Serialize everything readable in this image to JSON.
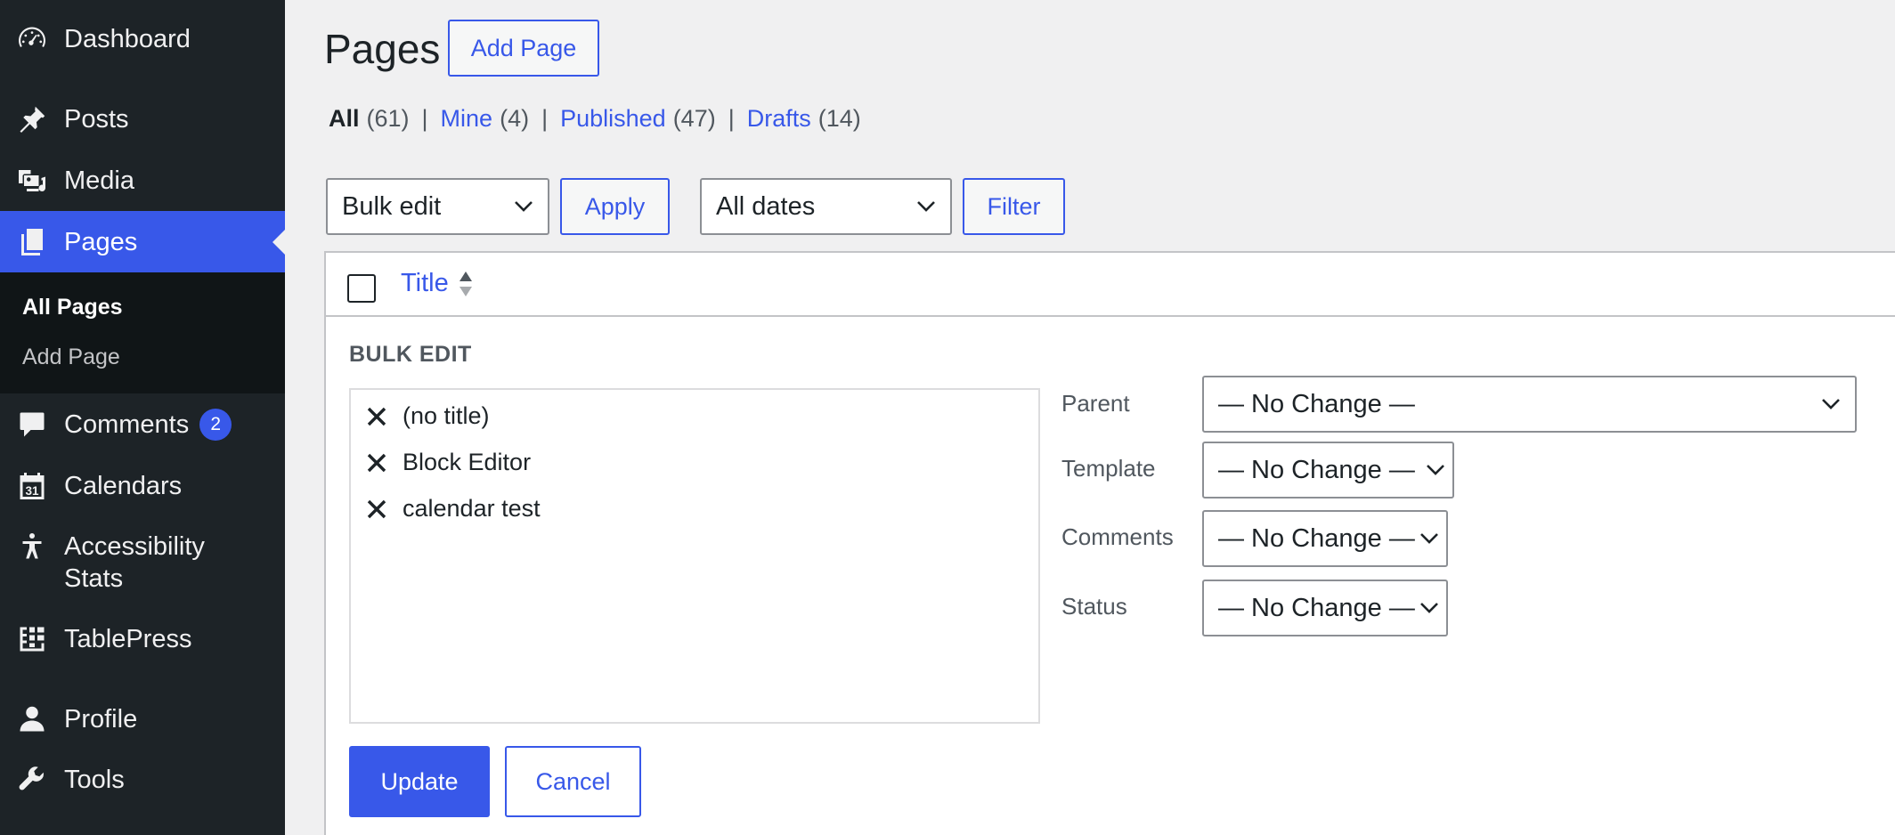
{
  "sidebar": {
    "items": [
      {
        "label": "Dashboard",
        "icon": "dashboard-icon"
      },
      {
        "label": "Posts",
        "icon": "pin-icon"
      },
      {
        "label": "Media",
        "icon": "media-icon"
      },
      {
        "label": "Pages",
        "icon": "pages-icon",
        "active": true
      },
      {
        "label": "Comments",
        "icon": "comment-icon",
        "badge": "2"
      },
      {
        "label": "Calendars",
        "icon": "calendar-icon",
        "icon_text": "31"
      },
      {
        "label": "Accessibility",
        "label_line2": "Stats",
        "icon": "accessibility-icon"
      },
      {
        "label": "TablePress",
        "icon": "tablepress-icon"
      },
      {
        "label": "Profile",
        "icon": "user-icon"
      },
      {
        "label": "Tools",
        "icon": "wrench-icon"
      }
    ],
    "submenu": [
      {
        "label": "All Pages",
        "current": true
      },
      {
        "label": "Add Page"
      }
    ]
  },
  "header": {
    "title": "Pages",
    "add_button": "Add Page"
  },
  "filters": [
    {
      "label": "All",
      "count": "(61)",
      "current": true
    },
    {
      "label": "Mine",
      "count": "(4)"
    },
    {
      "label": "Published",
      "count": "(47)"
    },
    {
      "label": "Drafts",
      "count": "(14)"
    }
  ],
  "filters_separator": "|",
  "toolbar": {
    "bulk_action": "Bulk edit",
    "apply": "Apply",
    "dates": "All dates",
    "filter": "Filter"
  },
  "table": {
    "title_column": "Title"
  },
  "bulk_edit": {
    "heading": "BULK EDIT",
    "items": [
      "(no title)",
      "Block Editor",
      "calendar test"
    ],
    "fields": [
      {
        "label": "Parent",
        "value": "— No Change —"
      },
      {
        "label": "Template",
        "value": "— No Change —"
      },
      {
        "label": "Comments",
        "value": "— No Change —"
      },
      {
        "label": "Status",
        "value": "— No Change —"
      }
    ],
    "update": "Update",
    "cancel": "Cancel"
  },
  "colors": {
    "sidebar_bg": "#1d2327",
    "accent": "#3858e9",
    "page_bg": "#f0f0f1"
  }
}
